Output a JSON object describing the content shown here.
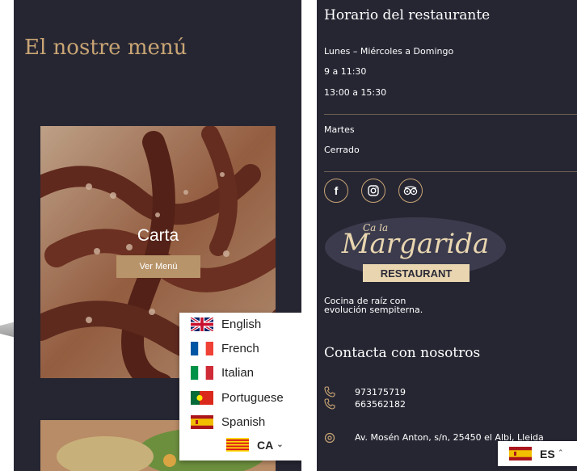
{
  "left": {
    "title": "El nostre menú",
    "card1": {
      "title": "Carta",
      "button": "Ver Menú"
    },
    "languages": [
      {
        "label": "English",
        "flag": "uk-flag-icon"
      },
      {
        "label": "French",
        "flag": "france-flag-icon"
      },
      {
        "label": "Italian",
        "flag": "italy-flag-icon"
      },
      {
        "label": "Portuguese",
        "flag": "portugal-flag-icon"
      },
      {
        "label": "Spanish",
        "flag": "spain-flag-icon"
      }
    ],
    "current_lang": "CA"
  },
  "right": {
    "hours_title": "Horario del restaurante",
    "hours_line1": "Lunes – Miércoles a Domingo",
    "hours_line2": "9 a 11:30",
    "hours_line3": "13:00 a 15:30",
    "closed_day": "Martes",
    "closed_label": "Cerrado",
    "social": [
      "facebook-icon",
      "instagram-icon",
      "tripadvisor-icon"
    ],
    "logo": {
      "script_text": "Margarida",
      "small_text": "Ca la",
      "banner": "RESTAURANT"
    },
    "tagline1": "Cocina de raíz con",
    "tagline2": "evolución sempiterna.",
    "contact_title": "Contacta con nosotros",
    "phone1": "973175719",
    "phone2": "663562182",
    "address": "Av. Mosén Anton, s/n, 25450 el Albi, Lleida",
    "current_lang": "ES"
  },
  "colors": {
    "panel": "#262633",
    "accent": "#c9a574"
  }
}
